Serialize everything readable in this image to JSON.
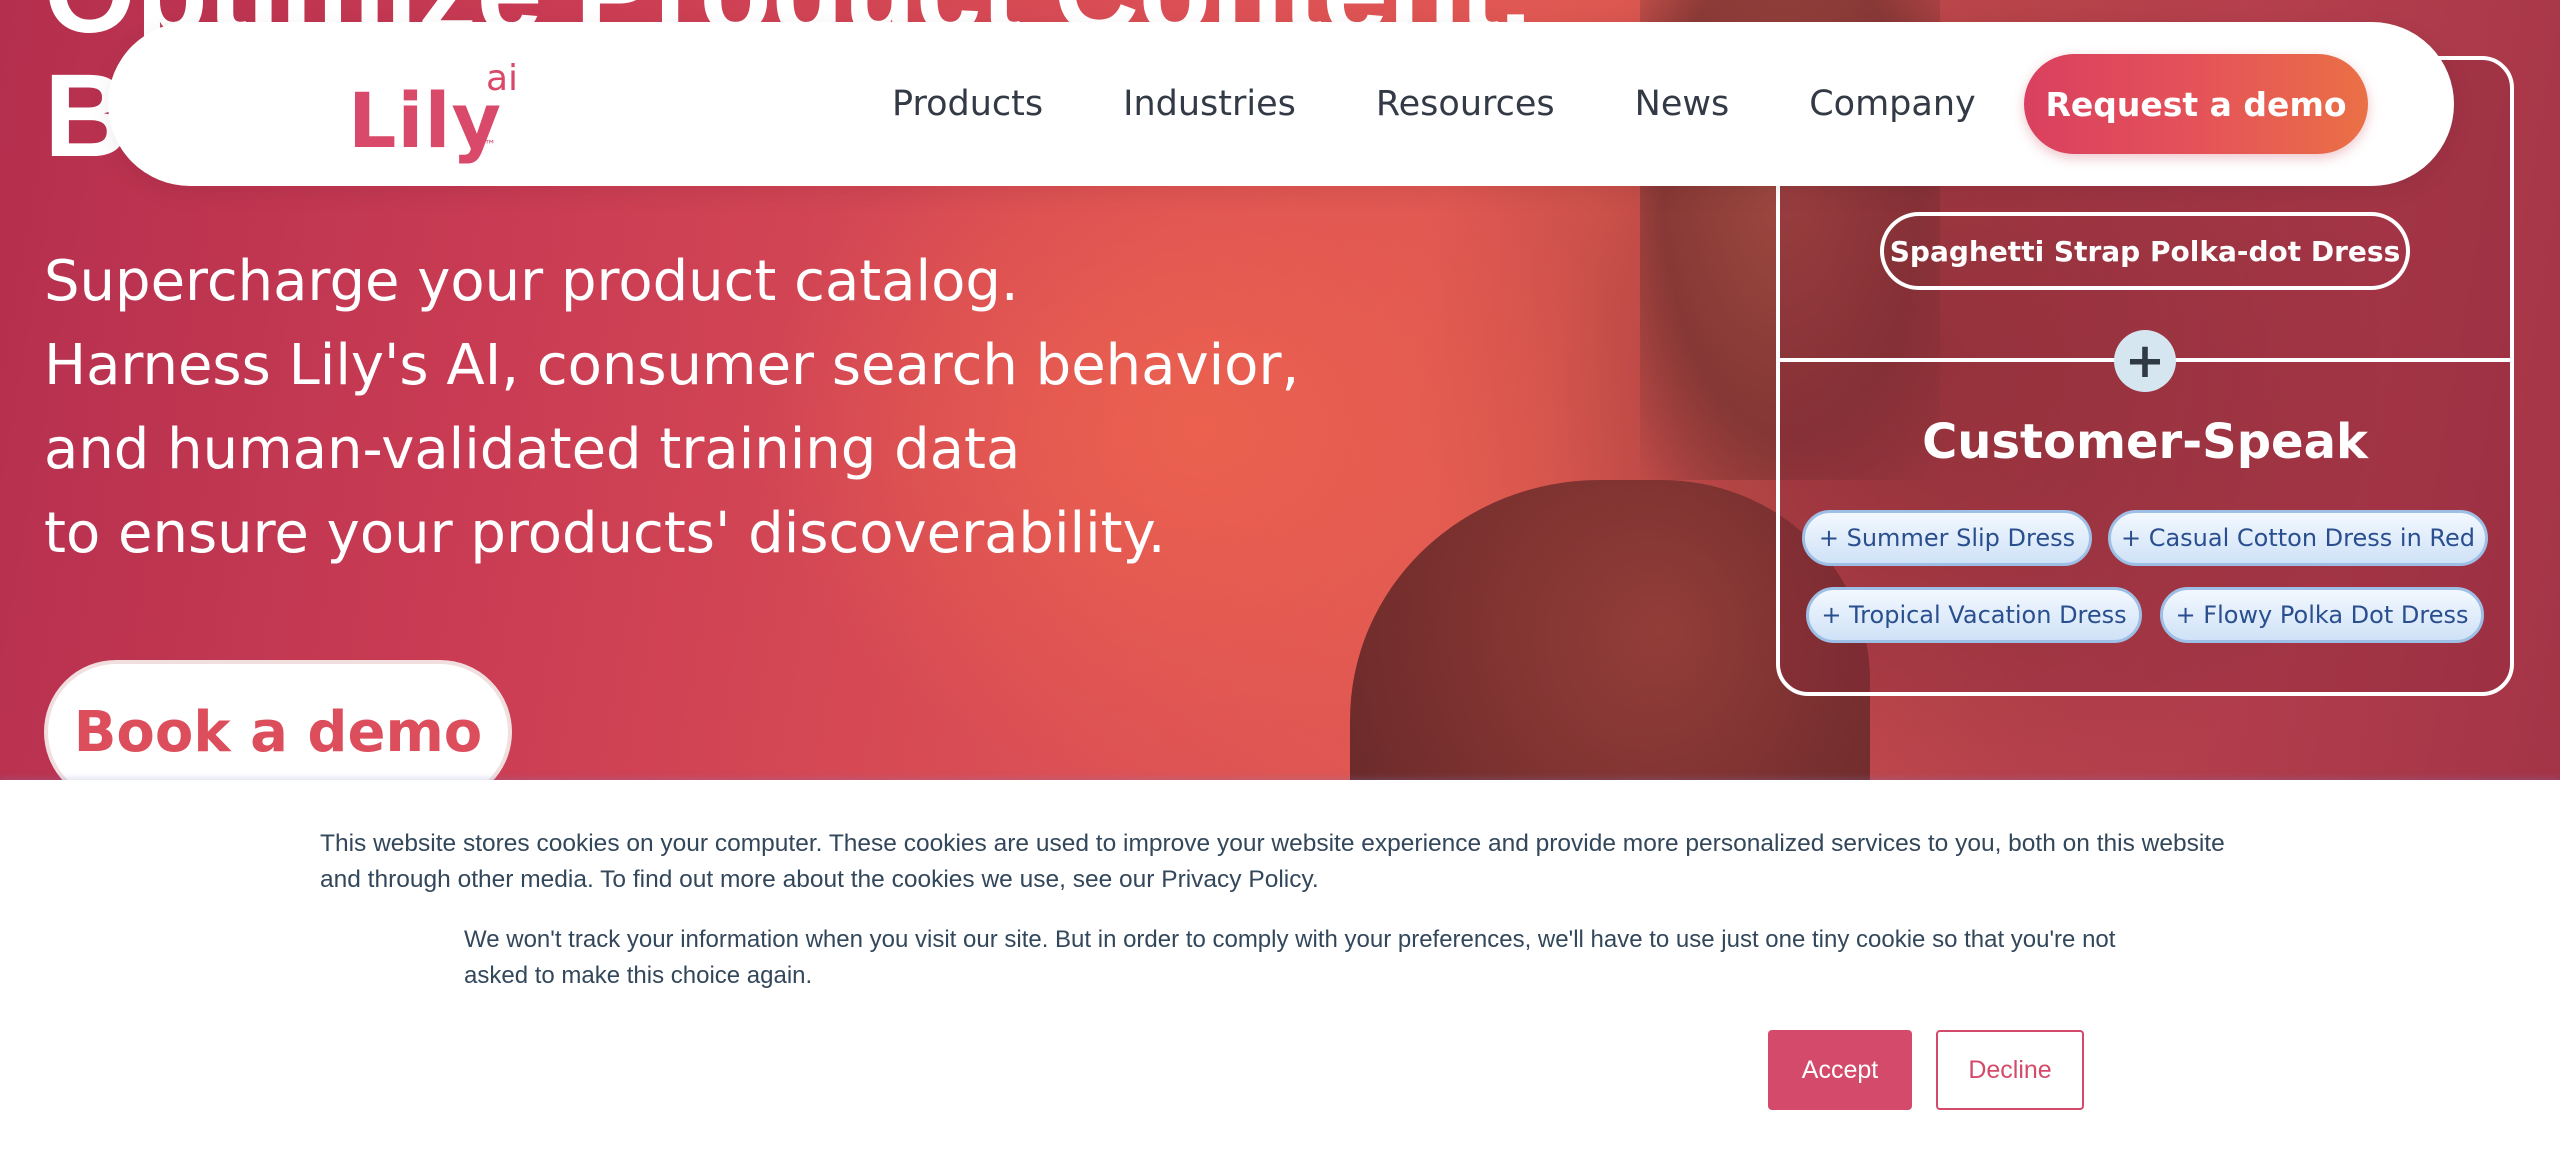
{
  "hero": {
    "title_line1": "Optimize Product Content.",
    "title_line2": "B",
    "subtitle": [
      "Supercharge your product catalog.",
      "Harness Lily's AI, consumer search behavior,",
      "and human-validated training data",
      "to ensure your products' discoverability."
    ],
    "book_demo_label": "Book a demo"
  },
  "nav": {
    "logo_text": "Lily",
    "logo_superscript": "ai",
    "logo_tm": "™",
    "links": [
      "Products",
      "Industries",
      "Resources",
      "News",
      "Company"
    ],
    "cta_label": "Request a demo"
  },
  "card": {
    "product_name": "Spaghetti Strap Polka-dot Dress",
    "plus_symbol": "+",
    "heading": "Customer-Speak",
    "tags": [
      "+ Summer Slip Dress",
      "+ Casual Cotton Dress in Red",
      "+ Tropical Vacation Dress",
      "+ Flowy Polka Dot Dress"
    ]
  },
  "cookie_banner": {
    "text_main": "This website stores cookies on your computer. These cookies are used to improve your website experience and provide more personalized services to you, both on this website and through other media. To find out more about the cookies we use, see our Privacy Policy.",
    "text_secondary": "We won't track your information when you visit our site. But in order to comply with your preferences, we'll have to use just one tiny cookie so that you're not asked to make this choice again.",
    "accept_label": "Accept",
    "decline_label": "Decline"
  },
  "colors": {
    "brand_pink": "#d9496a",
    "accept_bg": "#d44a6a",
    "hero_red": "#dc5055",
    "tag_text": "#2a4f8f"
  }
}
